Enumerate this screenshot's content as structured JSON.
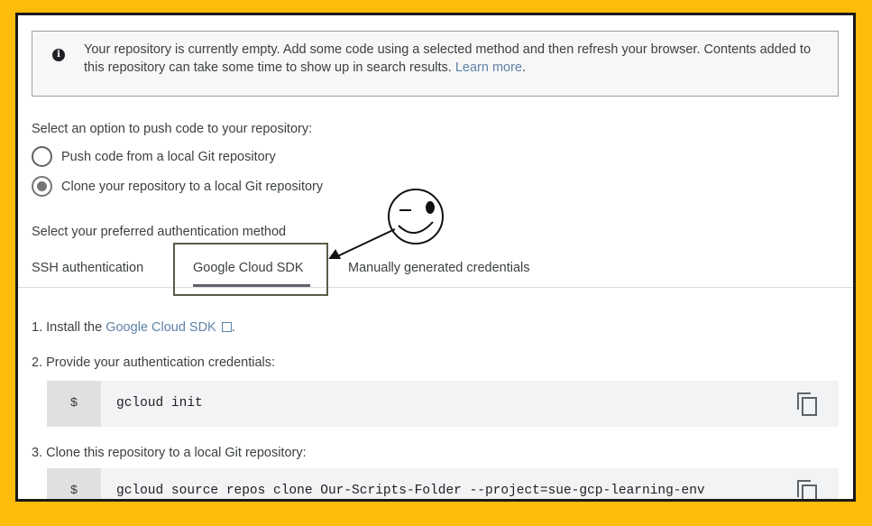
{
  "banner": {
    "message": "Your repository is currently empty. Add some code using a selected method and then refresh your browser. Contents added to this repository can take some time to show up in search results.",
    "learn_more": "Learn more",
    "period": "."
  },
  "push_options": {
    "prompt": "Select an option to push code to your repository:",
    "options": [
      {
        "label": "Push code from a local Git repository",
        "selected": false
      },
      {
        "label": "Clone your repository to a local Git repository",
        "selected": true
      }
    ]
  },
  "auth": {
    "prompt": "Select your preferred authentication method",
    "tabs": [
      {
        "label": "SSH authentication",
        "active": false
      },
      {
        "label": "Google Cloud SDK",
        "active": true
      },
      {
        "label": "Manually generated credentials",
        "active": false
      }
    ]
  },
  "steps": {
    "step1_prefix": "1. Install the ",
    "step1_link": "Google Cloud SDK",
    "step1_suffix": ".",
    "step2": "2. Provide your authentication credentials:",
    "step2_prompt": "$",
    "step2_command": "gcloud init",
    "step3": "3. Clone this repository to a local Git repository:",
    "step3_prompt": "$",
    "step3_command": "gcloud source repos clone Our-Scripts-Folder --project=sue-gcp-learning-env"
  },
  "colors": {
    "background": "#fdbb0a",
    "link": "#5f82a8",
    "highlight_box": "#5b5b48"
  }
}
